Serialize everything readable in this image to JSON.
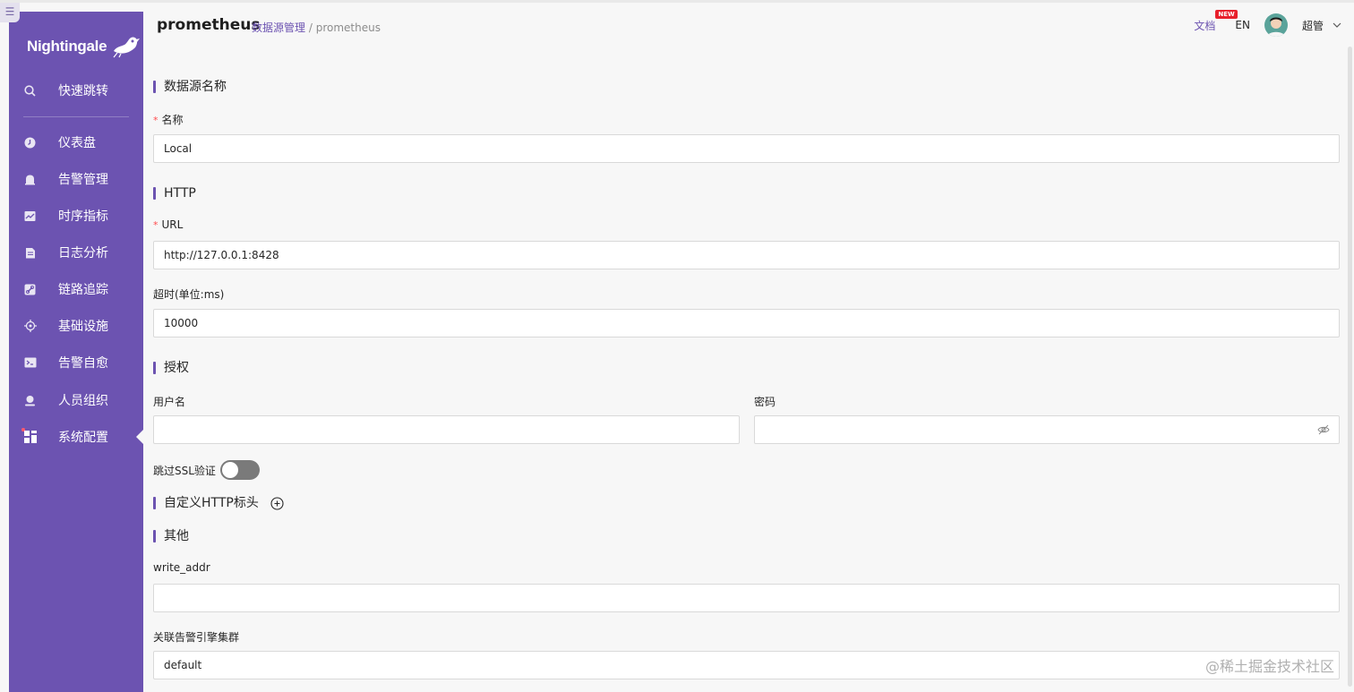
{
  "app": {
    "logo_text": "Nightingale"
  },
  "sidebar": {
    "items": [
      {
        "label": "快速跳转",
        "icon": "search-icon"
      },
      {
        "label": "仪表盘",
        "icon": "dashboard-icon"
      },
      {
        "label": "告警管理",
        "icon": "alarm-bell-icon"
      },
      {
        "label": "时序指标",
        "icon": "line-chart-icon"
      },
      {
        "label": "日志分析",
        "icon": "log-file-icon"
      },
      {
        "label": "链路追踪",
        "icon": "trace-link-icon"
      },
      {
        "label": "基础设施",
        "icon": "crosshair-icon"
      },
      {
        "label": "告警自愈",
        "icon": "terminal-icon"
      },
      {
        "label": "人员组织",
        "icon": "user-icon"
      },
      {
        "label": "系统配置",
        "icon": "grid-settings-icon",
        "active": true
      }
    ]
  },
  "header": {
    "title": "prometheus",
    "breadcrumb_link": "数据源管理",
    "breadcrumb_sep": "/",
    "breadcrumb_current": "prometheus",
    "docs_label": "文档",
    "new_badge": "NEW",
    "lang": "EN",
    "username": "超管"
  },
  "form": {
    "section_name": "数据源名称",
    "name_label": "名称",
    "name_value": "Local",
    "section_http": "HTTP",
    "url_label": "URL",
    "url_value": "http://127.0.0.1:8428",
    "timeout_label": "超时(单位:ms)",
    "timeout_value": "10000",
    "section_auth": "授权",
    "username_label": "用户名",
    "username_value": "",
    "password_label": "密码",
    "password_value": "",
    "skip_ssl_label": "跳过SSL验证",
    "skip_ssl_enabled": false,
    "section_headers": "自定义HTTP标头",
    "section_other": "其他",
    "write_addr_label": "write_addr",
    "write_addr_value": "",
    "cluster_label": "关联告警引擎集群",
    "cluster_value": "default"
  },
  "watermark": "@稀土掘金技术社区",
  "colors": {
    "brand": "#6c53b1",
    "required": "#ff4d4f",
    "badge": "#e8202c"
  }
}
